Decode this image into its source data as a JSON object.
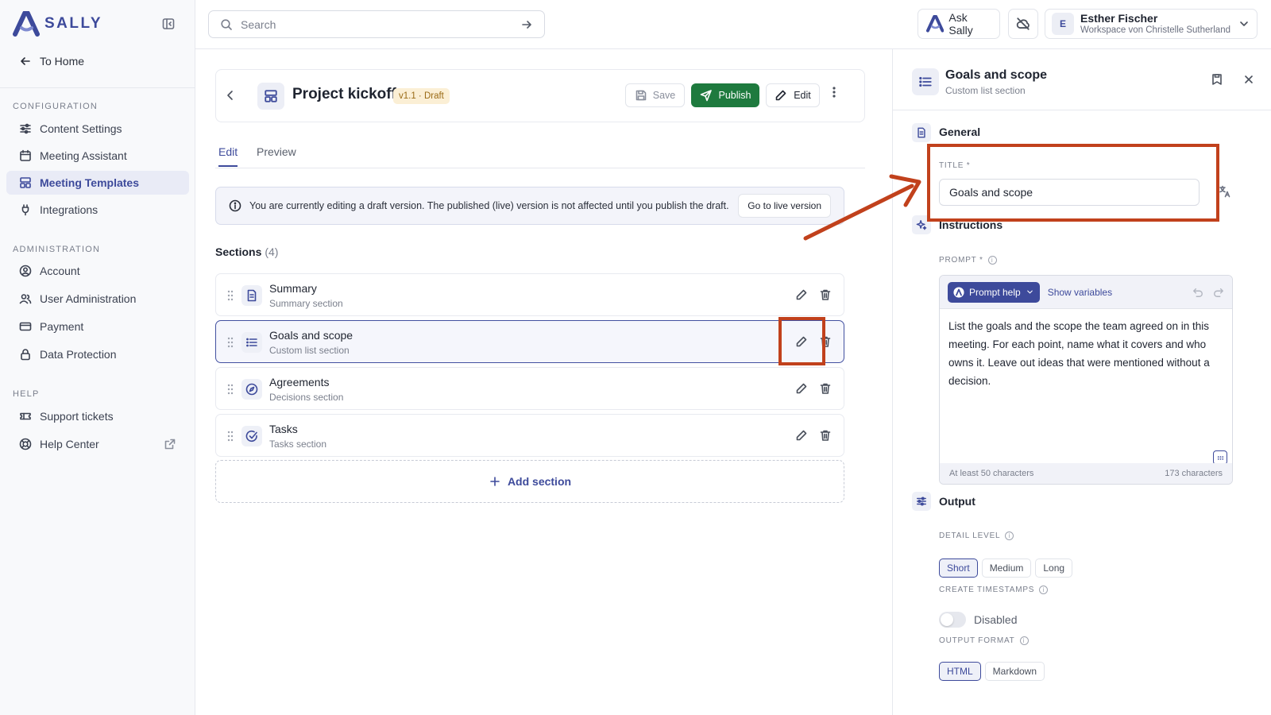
{
  "app": {
    "name": "SALLY",
    "brand_color": "#3d4a9b"
  },
  "sidebar": {
    "to_home": "To Home",
    "sections": {
      "configuration": "CONFIGURATION",
      "administration": "ADMINISTRATION",
      "help": "HELP"
    },
    "items": [
      {
        "label": "Content Settings",
        "icon": "sliders-icon"
      },
      {
        "label": "Meeting Assistant",
        "icon": "calendar-icon"
      },
      {
        "label": "Meeting Templates",
        "icon": "template-icon",
        "active": true
      },
      {
        "label": "Integrations",
        "icon": "plug-icon"
      },
      {
        "label": "Account",
        "icon": "user-circle-icon"
      },
      {
        "label": "User Administration",
        "icon": "users-icon"
      },
      {
        "label": "Payment",
        "icon": "card-icon"
      },
      {
        "label": "Data Protection",
        "icon": "lock-icon"
      },
      {
        "label": "Support tickets",
        "icon": "ticket-icon"
      },
      {
        "label": "Help Center",
        "icon": "lifebuoy-icon"
      }
    ]
  },
  "topbar": {
    "search_placeholder": "Search",
    "ask_sally": "Ask Sally",
    "user_initial": "E",
    "user_name": "Esther Fischer",
    "workspace": "Workspace von Christelle Sutherland"
  },
  "template": {
    "title": "Project kickoff",
    "badge": "v1.1 · Draft",
    "save": "Save",
    "publish": "Publish",
    "edit": "Edit",
    "publish_color": "#1e7a3e"
  },
  "tabs": {
    "edit": "Edit",
    "preview": "Preview"
  },
  "notice": {
    "text": "You are currently editing a draft version. The published (live) version is not affected until you publish the draft.",
    "button": "Go to live version"
  },
  "sections": {
    "title": "Sections",
    "count": "(4)",
    "items": [
      {
        "name": "Summary",
        "type": "Summary section"
      },
      {
        "name": "Goals and scope",
        "type": "Custom list section",
        "selected": true
      },
      {
        "name": "Agreements",
        "type": "Decisions section"
      },
      {
        "name": "Tasks",
        "type": "Tasks section"
      }
    ],
    "add": "Add section"
  },
  "panel": {
    "title": "Goals and scope",
    "subtitle": "Custom list section",
    "general": "General",
    "title_label": "TITLE *",
    "title_value": "Goals and scope",
    "instructions": "Instructions",
    "prompt_label": "PROMPT *",
    "prompt_help": "Prompt help",
    "show_variables": "Show variables",
    "prompt_text": "List the goals and the scope the team agreed on in this meeting. For each point, name what it covers and who owns it. Leave out ideas that were mentioned without a decision.",
    "min_chars": "At least 50 characters",
    "char_count": "173 characters",
    "output": "Output",
    "detail_level_label": "DETAIL LEVEL",
    "detail_levels": [
      "Short",
      "Medium",
      "Long"
    ],
    "timestamps_label": "CREATE TIMESTAMPS",
    "timestamps_state": "Disabled",
    "format_label": "OUTPUT FORMAT",
    "formats": [
      "HTML",
      "Markdown"
    ]
  },
  "annotation_color": "#c1411c"
}
